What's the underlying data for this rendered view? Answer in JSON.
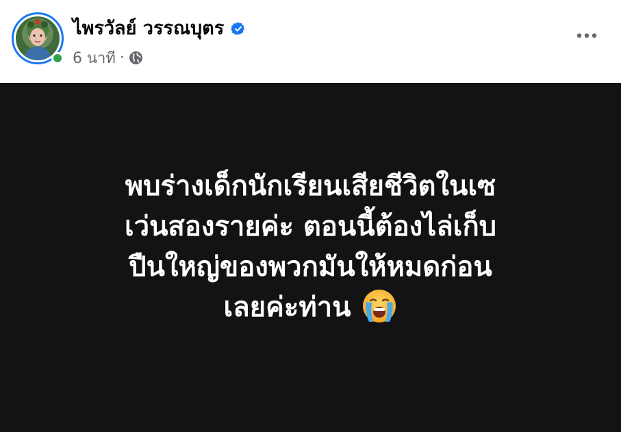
{
  "header": {
    "author_name": "ไพรวัลย์ วรรณบุตร",
    "timestamp": "6 นาที",
    "separator": "·",
    "privacy_icon": "globe-icon",
    "verified_icon": "verified-badge-icon",
    "more_icon": "more-horizontal-icon",
    "online_status": "online"
  },
  "post": {
    "lines": [
      "พบร่างเด็กนักเรียนเสียชีวิตในเซ",
      "เว่นสองรายค่ะ ตอนนี้ต้องไล่เก็บ",
      "ปืนใหญ่ของพวกมันให้หมดก่อน",
      "เลยค่ะท่าน"
    ],
    "emoji": "loudly-crying-face-icon"
  },
  "colors": {
    "verified": "#1877f2",
    "online": "#31a24c",
    "post_background": "#131313",
    "post_text": "#ffffff",
    "meta_text": "#65676b"
  }
}
